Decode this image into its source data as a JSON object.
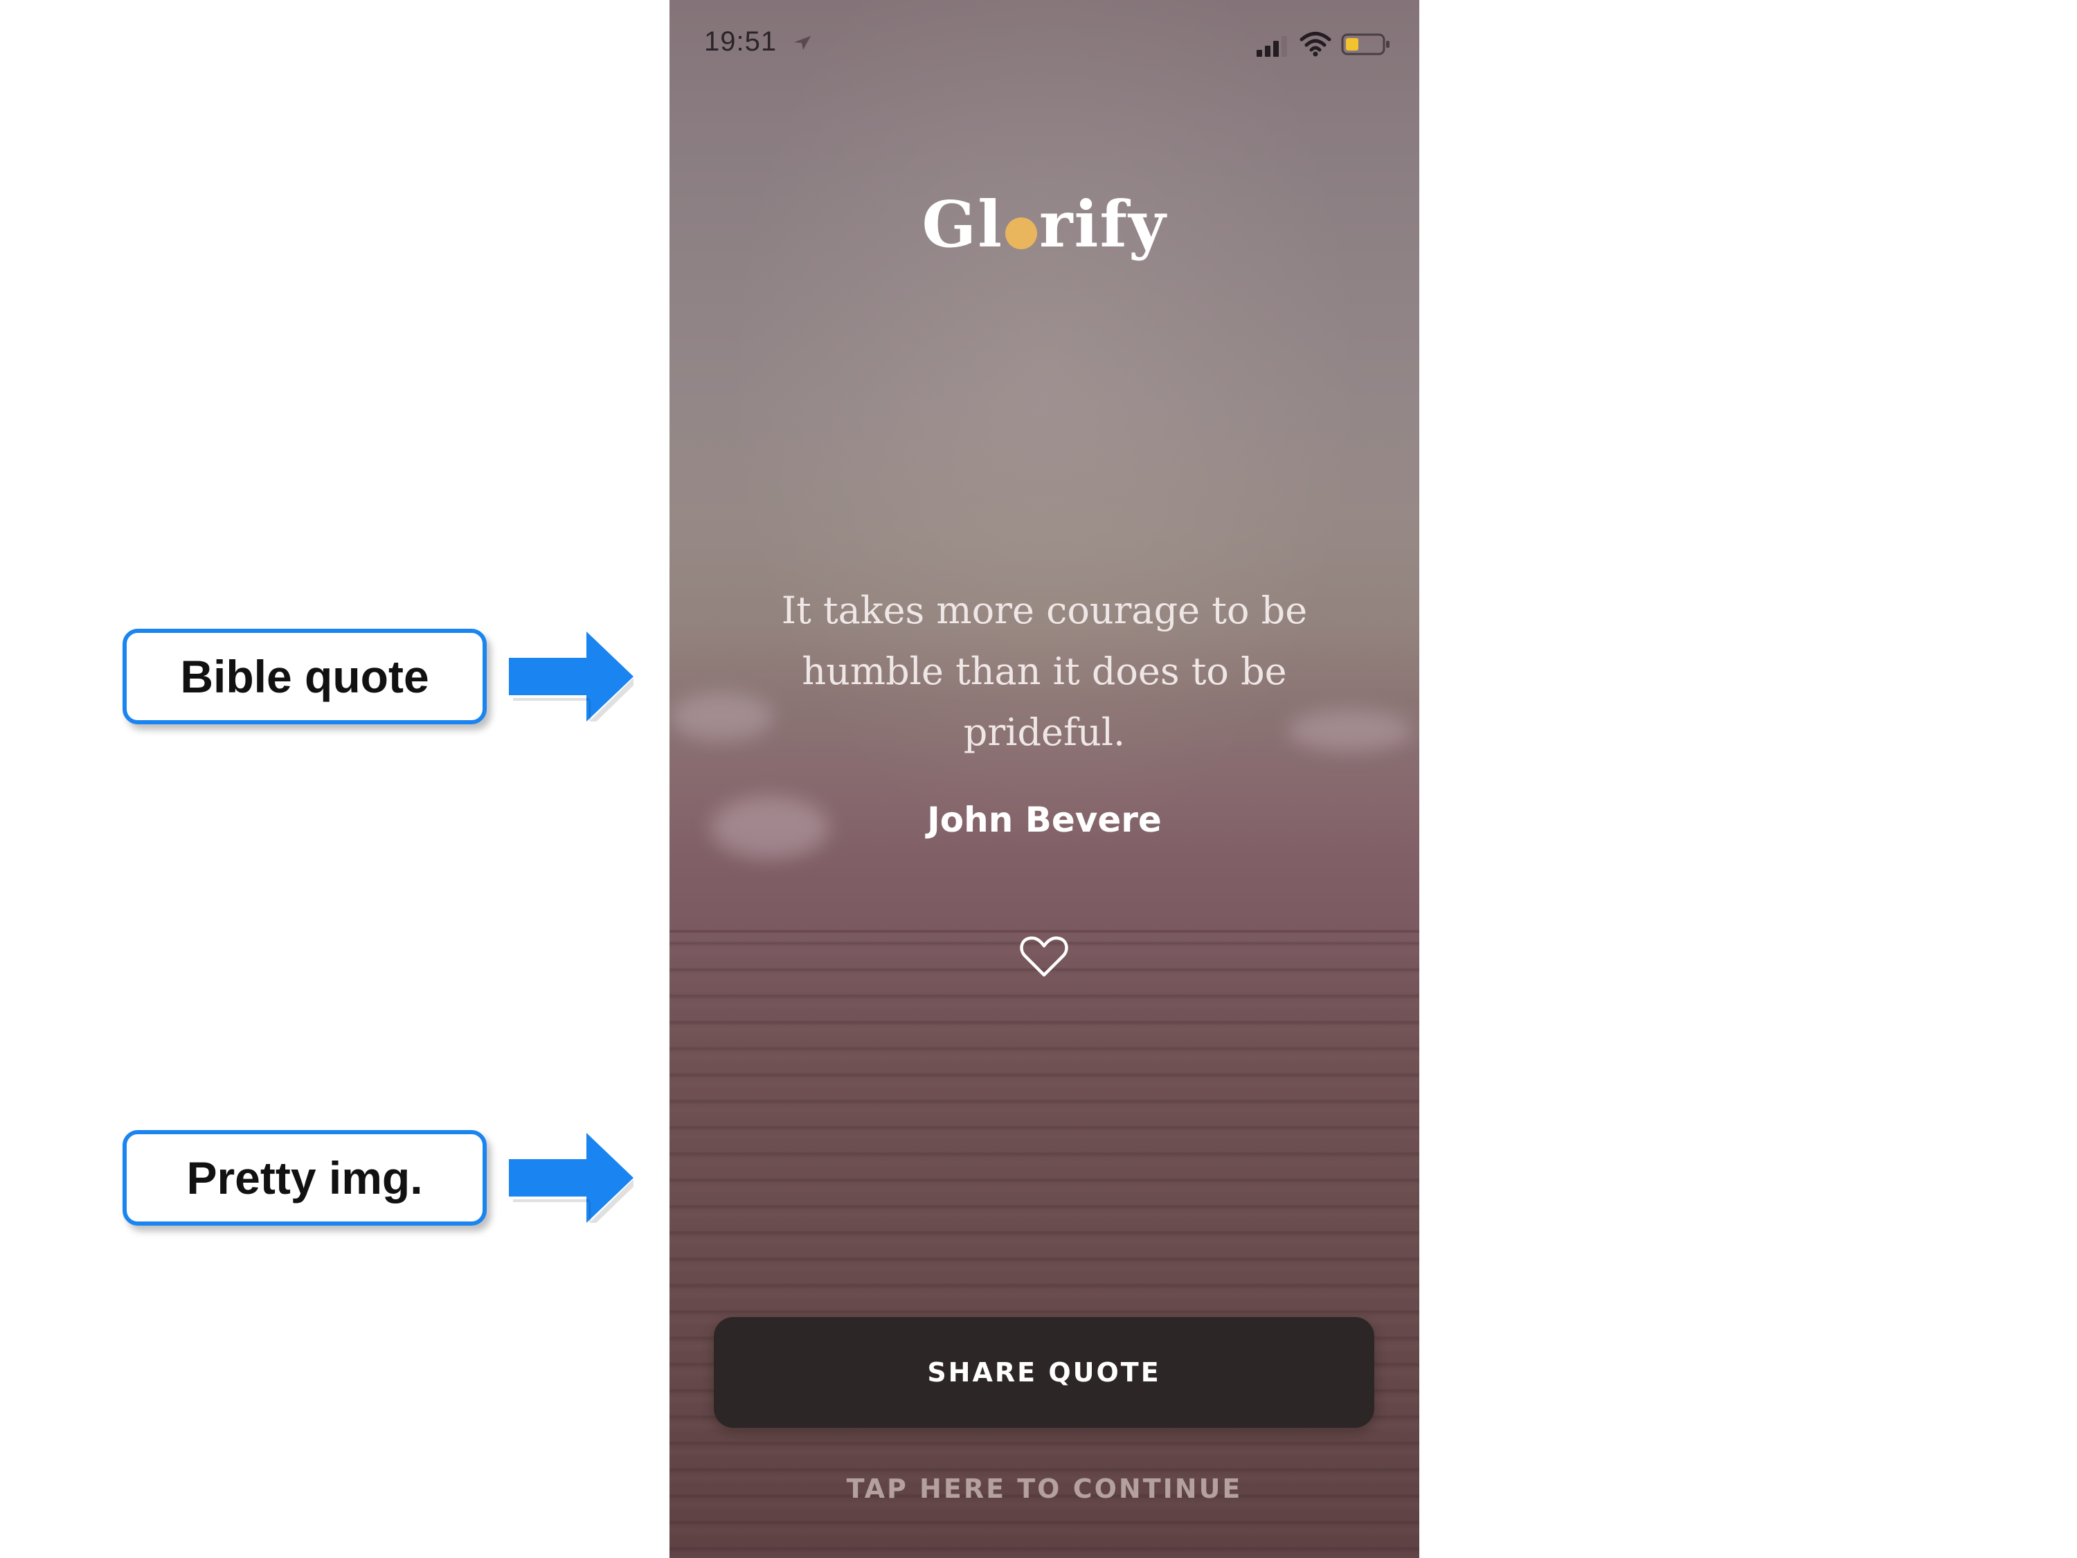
{
  "annotations": {
    "bible_quote_label": "Bible quote",
    "pretty_img_label": "Pretty img."
  },
  "status_bar": {
    "time": "19:51",
    "location_icon": "location-arrow-icon",
    "signal_icon": "cellular-signal-icon",
    "wifi_icon": "wifi-icon",
    "battery_icon": "battery-icon",
    "battery_level": 0.3,
    "battery_color": "#f2c230"
  },
  "app": {
    "logo_before_dot": "Gl",
    "logo_after_dot": "rify",
    "logo_dot_color": "#e9b65e"
  },
  "quote": {
    "text": "It takes more courage to be humble than it does to be prideful.",
    "author": "John Bevere",
    "favorite_icon": "heart-outline-icon"
  },
  "actions": {
    "share_label": "SHARE QUOTE",
    "continue_label": "TAP HERE TO CONTINUE"
  },
  "colors": {
    "callout_border": "#1a84f0",
    "arrow": "#1a84f0",
    "button_bg": "#2d2627"
  }
}
